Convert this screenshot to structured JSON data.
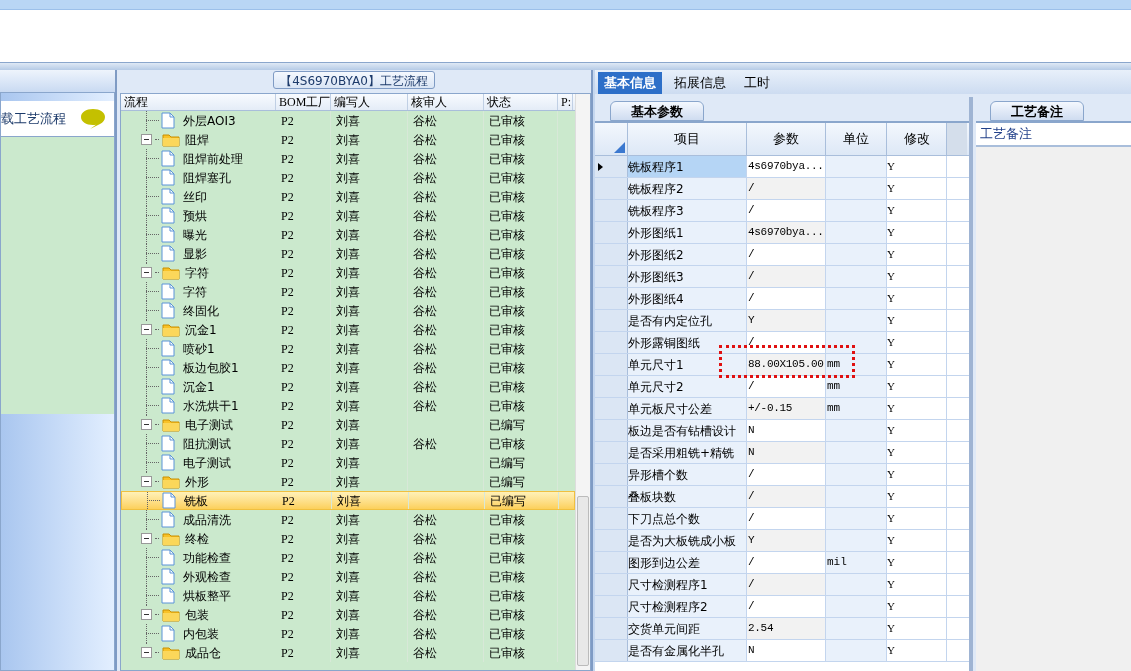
{
  "left_panel": {
    "item": "载工艺流程"
  },
  "flow_panel": {
    "title": "【4S6970BYA0】工艺流程",
    "columns": [
      "流程",
      "BOM工厂",
      "编写人",
      "核审人",
      "状态",
      "P:"
    ],
    "rows": [
      {
        "kind": "file",
        "name": "外层AOI3",
        "factory": "P2",
        "writer": "刘喜",
        "reviewer": "谷松",
        "status": "已审核",
        "selected": false
      },
      {
        "kind": "folder",
        "name": "阻焊",
        "factory": "P2",
        "writer": "刘喜",
        "reviewer": "谷松",
        "status": "已审核",
        "selected": false,
        "children": [
          {
            "kind": "file",
            "name": "阻焊前处理",
            "factory": "P2",
            "writer": "刘喜",
            "reviewer": "谷松",
            "status": "已审核",
            "selected": false
          },
          {
            "kind": "file",
            "name": "阻焊塞孔",
            "factory": "P2",
            "writer": "刘喜",
            "reviewer": "谷松",
            "status": "已审核",
            "selected": false
          },
          {
            "kind": "file",
            "name": "丝印",
            "factory": "P2",
            "writer": "刘喜",
            "reviewer": "谷松",
            "status": "已审核",
            "selected": false
          },
          {
            "kind": "file",
            "name": "预烘",
            "factory": "P2",
            "writer": "刘喜",
            "reviewer": "谷松",
            "status": "已审核",
            "selected": false
          },
          {
            "kind": "file",
            "name": "曝光",
            "factory": "P2",
            "writer": "刘喜",
            "reviewer": "谷松",
            "status": "已审核",
            "selected": false
          },
          {
            "kind": "file",
            "name": "显影",
            "factory": "P2",
            "writer": "刘喜",
            "reviewer": "谷松",
            "status": "已审核",
            "selected": false
          }
        ]
      },
      {
        "kind": "folder",
        "name": "字符",
        "factory": "P2",
        "writer": "刘喜",
        "reviewer": "谷松",
        "status": "已审核",
        "selected": false,
        "children": [
          {
            "kind": "file",
            "name": "字符",
            "factory": "P2",
            "writer": "刘喜",
            "reviewer": "谷松",
            "status": "已审核",
            "selected": false
          },
          {
            "kind": "file",
            "name": "终固化",
            "factory": "P2",
            "writer": "刘喜",
            "reviewer": "谷松",
            "status": "已审核",
            "selected": false
          }
        ]
      },
      {
        "kind": "folder",
        "name": "沉金1",
        "factory": "P2",
        "writer": "刘喜",
        "reviewer": "谷松",
        "status": "已审核",
        "selected": false,
        "children": [
          {
            "kind": "file",
            "name": "喷砂1",
            "factory": "P2",
            "writer": "刘喜",
            "reviewer": "谷松",
            "status": "已审核",
            "selected": false
          },
          {
            "kind": "file",
            "name": "板边包胶1",
            "factory": "P2",
            "writer": "刘喜",
            "reviewer": "谷松",
            "status": "已审核",
            "selected": false
          },
          {
            "kind": "file",
            "name": "沉金1",
            "factory": "P2",
            "writer": "刘喜",
            "reviewer": "谷松",
            "status": "已审核",
            "selected": false
          },
          {
            "kind": "file",
            "name": "水洗烘干1",
            "factory": "P2",
            "writer": "刘喜",
            "reviewer": "谷松",
            "status": "已审核",
            "selected": false
          }
        ]
      },
      {
        "kind": "folder",
        "name": "电子测试",
        "factory": "P2",
        "writer": "刘喜",
        "status": "已编写",
        "selected": false,
        "children": [
          {
            "kind": "file",
            "name": "阻抗测试",
            "factory": "P2",
            "writer": "刘喜",
            "reviewer": "谷松",
            "status": "已审核",
            "selected": false
          },
          {
            "kind": "file",
            "name": "电子测试",
            "factory": "P2",
            "writer": "刘喜",
            "status": "已编写",
            "selected": false
          }
        ]
      },
      {
        "kind": "folder",
        "name": "外形",
        "factory": "P2",
        "writer": "刘喜",
        "status": "已编写",
        "selected": false,
        "children": [
          {
            "kind": "file",
            "name": "铣板",
            "factory": "P2",
            "writer": "刘喜",
            "status": "已编写",
            "selected": true
          },
          {
            "kind": "file",
            "name": "成品清洗",
            "factory": "P2",
            "writer": "刘喜",
            "reviewer": "谷松",
            "status": "已审核",
            "selected": false
          }
        ]
      },
      {
        "kind": "folder",
        "name": "终检",
        "factory": "P2",
        "writer": "刘喜",
        "reviewer": "谷松",
        "status": "已审核",
        "selected": false,
        "children": [
          {
            "kind": "file",
            "name": "功能检查",
            "factory": "P2",
            "writer": "刘喜",
            "reviewer": "谷松",
            "status": "已审核",
            "selected": false
          },
          {
            "kind": "file",
            "name": "外观检查",
            "factory": "P2",
            "writer": "刘喜",
            "reviewer": "谷松",
            "status": "已审核",
            "selected": false
          },
          {
            "kind": "file",
            "name": "烘板整平",
            "factory": "P2",
            "writer": "刘喜",
            "reviewer": "谷松",
            "status": "已审核",
            "selected": false
          }
        ]
      },
      {
        "kind": "folder",
        "name": "包装",
        "factory": "P2",
        "writer": "刘喜",
        "reviewer": "谷松",
        "status": "已审核",
        "selected": false,
        "children": [
          {
            "kind": "file",
            "name": "内包装",
            "factory": "P2",
            "writer": "刘喜",
            "reviewer": "谷松",
            "status": "已审核",
            "selected": false
          }
        ]
      },
      {
        "kind": "folder",
        "name": "成品仓",
        "factory": "P2",
        "writer": "刘喜",
        "reviewer": "谷松",
        "status": "已审核",
        "selected": false
      }
    ]
  },
  "tabs": [
    {
      "label": "基本信息",
      "selected": true
    },
    {
      "label": "拓展信息",
      "selected": false
    },
    {
      "label": "工时",
      "selected": false
    }
  ],
  "params_panel": {
    "tab": "基本参数",
    "columns": [
      "项目",
      "参数",
      "单位",
      "修改"
    ],
    "rows": [
      {
        "item": "铣板程序1",
        "value": "4s6970bya...",
        "modified": "Y",
        "selected": true
      },
      {
        "item": "铣板程序2",
        "value": "/",
        "modified": "Y",
        "selected": false
      },
      {
        "item": "铣板程序3",
        "value": "/",
        "modified": "Y",
        "selected": false
      },
      {
        "item": "外形图纸1",
        "value": "4s6970bya...",
        "modified": "Y",
        "selected": false
      },
      {
        "item": "外形图纸2",
        "value": "/",
        "modified": "Y",
        "selected": false
      },
      {
        "item": "外形图纸3",
        "value": "/",
        "modified": "Y",
        "selected": false
      },
      {
        "item": "外形图纸4",
        "value": "/",
        "modified": "Y",
        "selected": false
      },
      {
        "item": "是否有内定位孔",
        "value": "Y",
        "modified": "Y",
        "selected": false
      },
      {
        "item": "外形露铜图纸",
        "value": "/",
        "modified": "Y",
        "selected": false
      },
      {
        "item": "单元尺寸1",
        "value": "88.00X105.00",
        "unit": "mm",
        "modified": "Y",
        "selected": false
      },
      {
        "item": "单元尺寸2",
        "value": "/",
        "unit": "mm",
        "modified": "Y",
        "selected": false
      },
      {
        "item": "单元板尺寸公差",
        "value": "+/-0.15",
        "unit": "mm",
        "modified": "Y",
        "selected": false
      },
      {
        "item": "板边是否有钻槽设计",
        "value": "N",
        "modified": "Y",
        "selected": false
      },
      {
        "item": "是否采用粗铣+精铣",
        "value": "N",
        "modified": "Y",
        "selected": false
      },
      {
        "item": "异形槽个数",
        "value": "/",
        "modified": "Y",
        "selected": false
      },
      {
        "item": "叠板块数",
        "value": "/",
        "modified": "Y",
        "selected": false
      },
      {
        "item": "下刀点总个数",
        "value": "/",
        "modified": "Y",
        "selected": false
      },
      {
        "item": "是否为大板铣成小板",
        "value": "Y",
        "modified": "Y",
        "selected": false
      },
      {
        "item": "图形到边公差",
        "value": "/",
        "unit": "mil",
        "modified": "Y",
        "selected": false
      },
      {
        "item": "尺寸检测程序1",
        "value": "/",
        "modified": "Y",
        "selected": false
      },
      {
        "item": "尺寸检测程序2",
        "value": "/",
        "modified": "Y",
        "selected": false
      },
      {
        "item": "交货单元间距",
        "value": "2.54",
        "modified": "Y",
        "selected": false
      },
      {
        "item": "是否有金属化半孔",
        "value": "N",
        "modified": "Y",
        "selected": false
      }
    ]
  },
  "notes_panel": {
    "tab": "工艺备注",
    "header": "工艺备注"
  }
}
